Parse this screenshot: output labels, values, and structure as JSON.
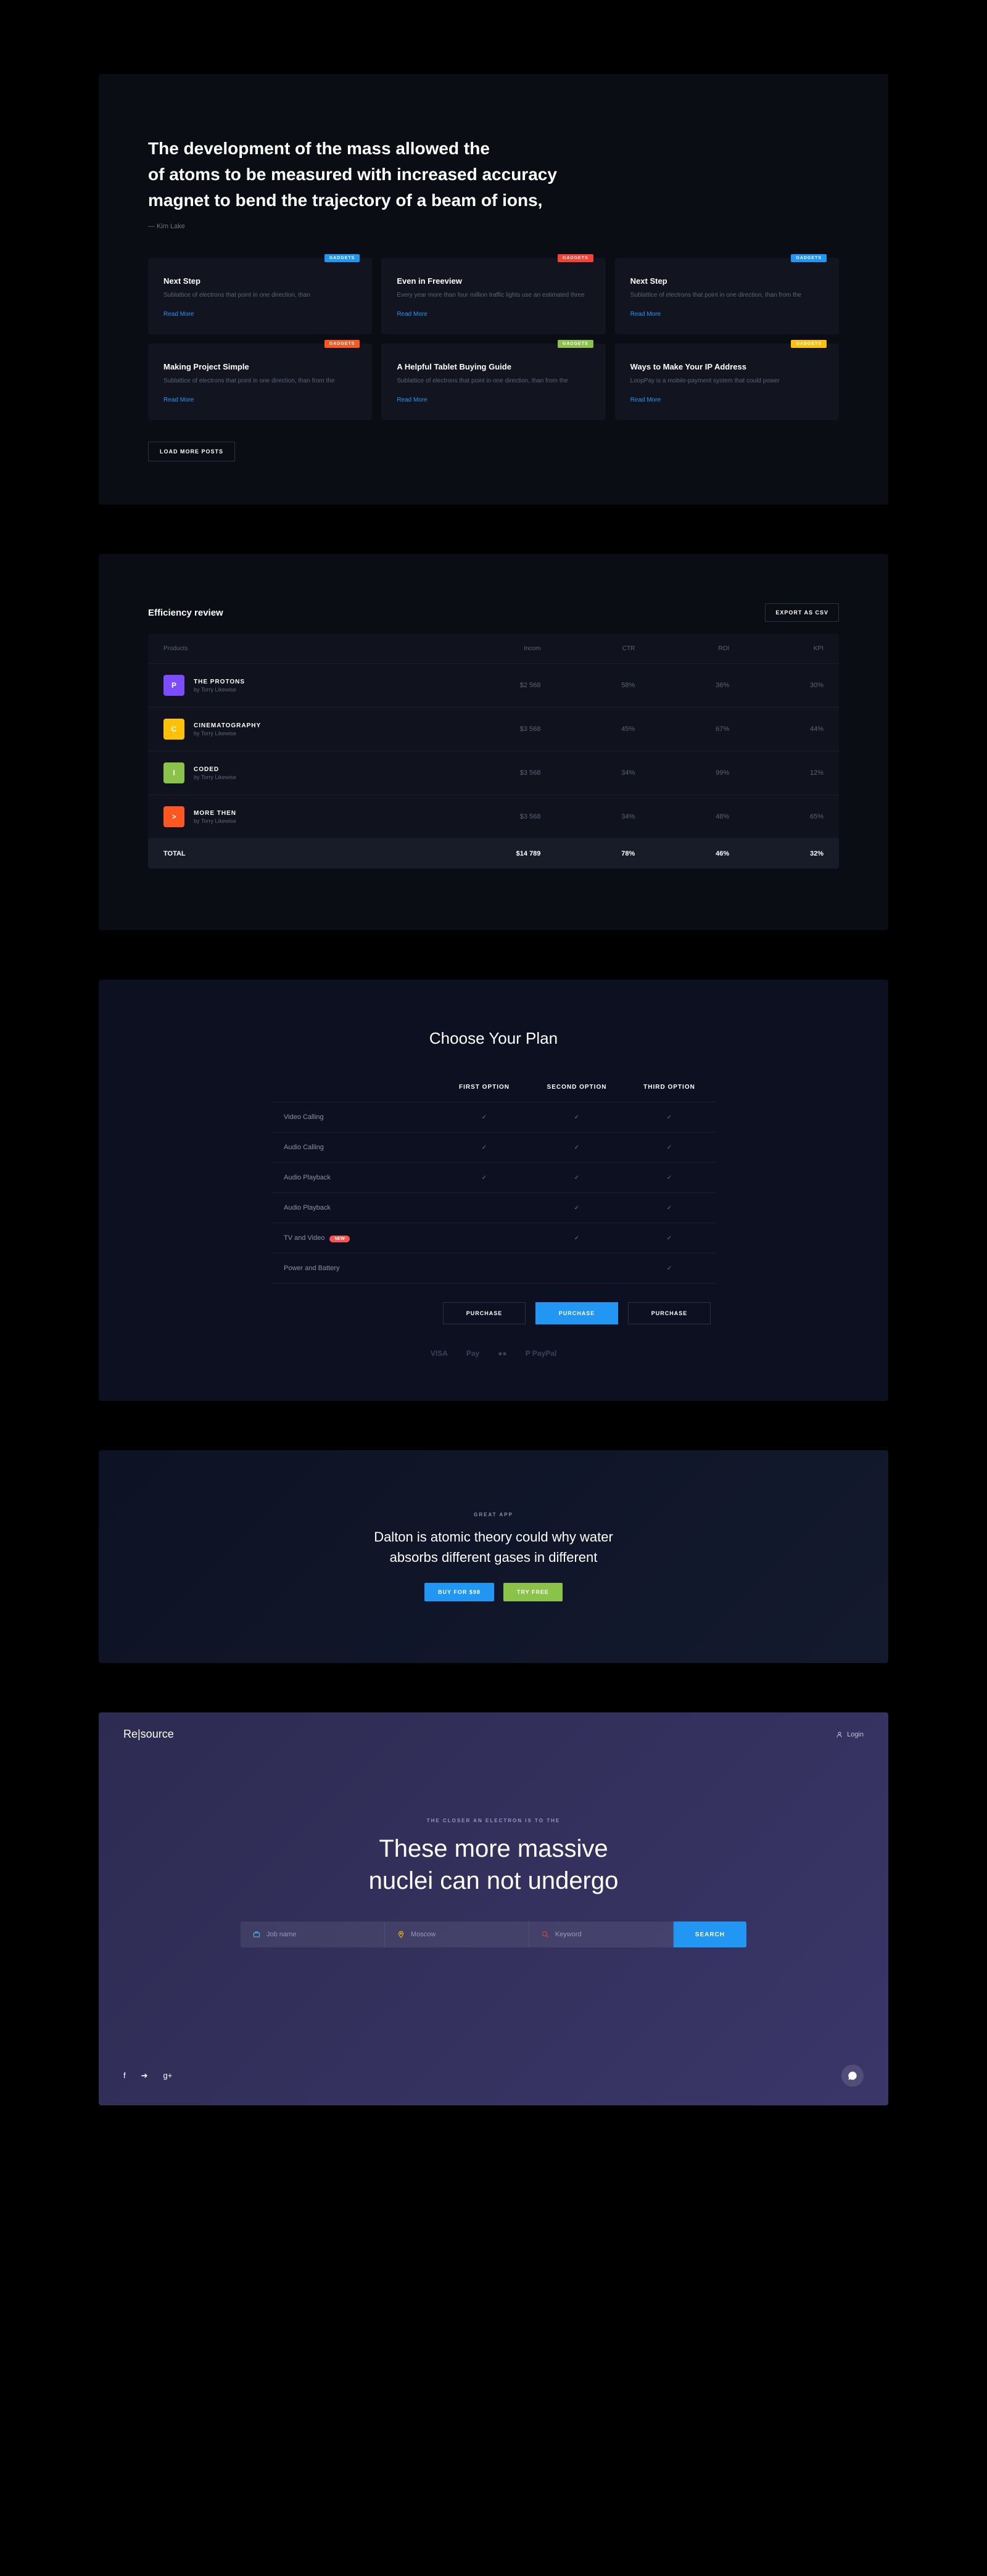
{
  "section1": {
    "quote_l1": "The development of the mass allowed the",
    "quote_l2": "of atoms to be measured with increased accuracy",
    "quote_l3": "magnet to bend the trajectory of a beam of ions,",
    "author": "— Kim Lake",
    "cards": [
      {
        "badge": "GADGETS",
        "badge_class": "b-blue",
        "title": "Next Step",
        "desc": "Sublattice of electrons that point in one direction, than",
        "link": "Read More"
      },
      {
        "badge": "GADGETS",
        "badge_class": "b-red",
        "title": "Even in Freeview",
        "desc": "Every year more than four million traffic lights use an estimated three",
        "link": "Read More"
      },
      {
        "badge": "GADGETS",
        "badge_class": "b-blue",
        "title": "Next Step",
        "desc": "Sublattice of electrons that point in one direction, than from the",
        "link": "Read More"
      },
      {
        "badge": "GADGETS",
        "badge_class": "b-orange",
        "title": "Making Project Simple",
        "desc": "Sublattice of electrons that point in one direction, than from the",
        "link": "Read More"
      },
      {
        "badge": "GADGETS",
        "badge_class": "b-green",
        "title": "A Helpful Tablet Buying Guide",
        "desc": "Sublattice of electrons that point in one direction, than from the",
        "link": "Read More"
      },
      {
        "badge": "GADGETS",
        "badge_class": "b-yellow",
        "title": "Ways to Make Your IP Address",
        "desc": "LoopPay is a mobile-payment system that could power",
        "link": "Read More"
      }
    ],
    "load_more": "LOAD MORE POSTS"
  },
  "section2": {
    "title": "Efficiency review",
    "export": "EXPORT AS CSV",
    "headers": [
      "Products",
      "Incom",
      "CTR",
      "ROI",
      "KPI"
    ],
    "rows": [
      {
        "icon": "P",
        "icon_class": "pi-purple",
        "name": "THE PROTONS",
        "author": "by Torry Likewise",
        "incom": "$2 568",
        "ctr": "58%",
        "roi": "36%",
        "kpi": "30%"
      },
      {
        "icon": "C",
        "icon_class": "pi-yellow",
        "name": "CINEMATOGRAPHY",
        "author": "by Torry Likewise",
        "incom": "$3 568",
        "ctr": "45%",
        "roi": "67%",
        "kpi": "44%"
      },
      {
        "icon": "I",
        "icon_class": "pi-green",
        "name": "CODED",
        "author": "by Torry Likewise",
        "incom": "$3 568",
        "ctr": "34%",
        "roi": "99%",
        "kpi": "12%"
      },
      {
        "icon": ">",
        "icon_class": "pi-orange",
        "name": "MORE THEN",
        "author": "by Torry Likewise",
        "incom": "$3 568",
        "ctr": "34%",
        "roi": "48%",
        "kpi": "65%"
      }
    ],
    "total_label": "TOTAL",
    "total": {
      "incom": "$14 789",
      "ctr": "78%",
      "roi": "46%",
      "kpi": "32%"
    }
  },
  "section3": {
    "title": "Choose Your Plan",
    "cols": [
      "FIRST OPTION",
      "SECOND OPTION",
      "THIRD OPTION"
    ],
    "features": [
      {
        "name": "Video Calling",
        "new": false,
        "v": [
          true,
          true,
          true
        ]
      },
      {
        "name": "Audio Calling",
        "new": false,
        "v": [
          true,
          true,
          true
        ]
      },
      {
        "name": "Audio Playback",
        "new": false,
        "v": [
          true,
          true,
          true
        ]
      },
      {
        "name": "Audio Playback",
        "new": false,
        "v": [
          false,
          true,
          true
        ]
      },
      {
        "name": "TV and Video",
        "new": true,
        "v": [
          false,
          true,
          true
        ]
      },
      {
        "name": "Power and Battery",
        "new": false,
        "v": [
          false,
          false,
          true
        ]
      }
    ],
    "new_label": "NEW",
    "purchase": "PURCHASE",
    "pay": [
      "VISA",
      "Pay",
      "mastercard",
      "PayPal"
    ]
  },
  "section4": {
    "eyebrow": "GREAT APP",
    "l1": "Dalton is atomic theory could why water",
    "l2": "absorbs different gases in different",
    "buy": "BUY FOR $98",
    "try": "TRY FREE"
  },
  "section5": {
    "logo": "Re|source",
    "login": "Login",
    "eyebrow": "THE CLOSER AN ELECTRON IS TO THE",
    "h1": "These more massive",
    "h2": "nuclei can not undergo",
    "ph_job": "Job name",
    "ph_loc": "Moscow",
    "ph_key": "Keyword",
    "search": "SEARCH",
    "social": [
      "f",
      "➔",
      "g+"
    ]
  }
}
